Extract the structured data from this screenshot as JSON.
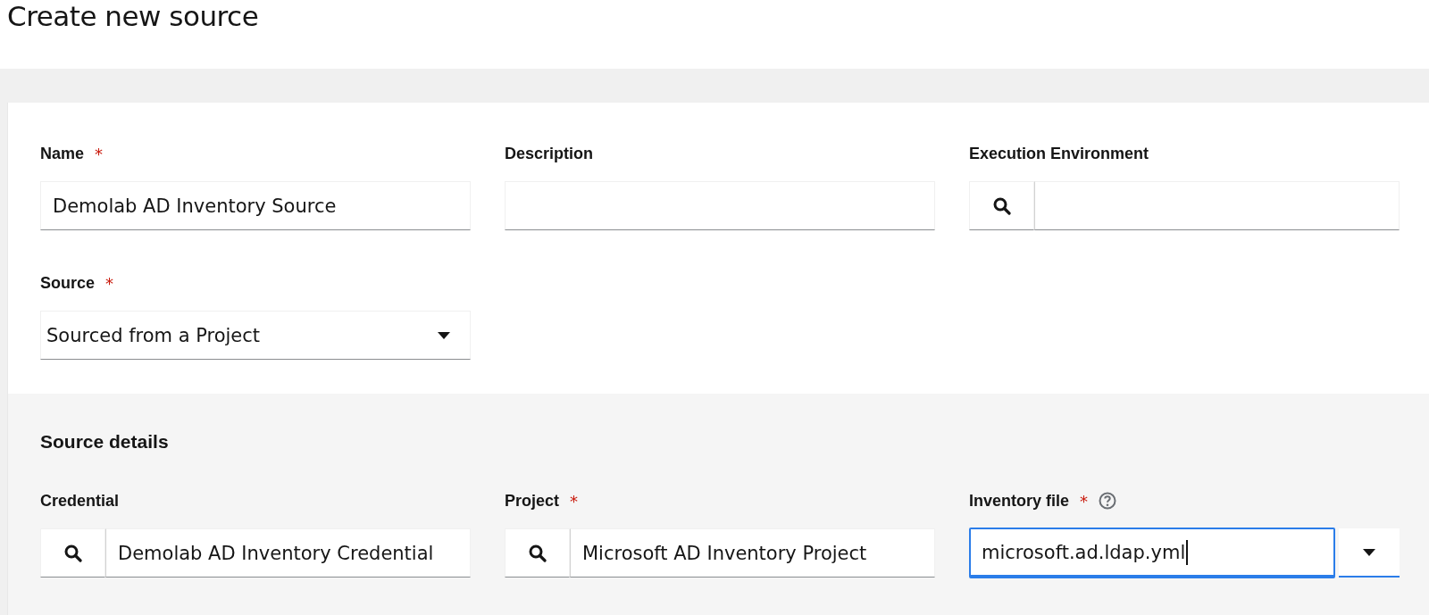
{
  "page": {
    "title": "Create new source"
  },
  "general": {
    "rows": [
      [
        {
          "kind": "text",
          "label": "Name",
          "required_mark": "*",
          "value": "Demolab AD Inventory Source"
        },
        {
          "kind": "text",
          "label": "Description"
        },
        {
          "kind": "lookup",
          "label": "Execution Environment"
        }
      ],
      [
        {
          "kind": "select",
          "label": "Source",
          "required_mark": "*",
          "value": "Sourced from a Project"
        }
      ]
    ]
  },
  "source_details": {
    "title": "Source details",
    "rows": [
      [
        {
          "kind": "lookup",
          "label": "Credential",
          "value": "Demolab AD Inventory Credential"
        },
        {
          "kind": "lookup",
          "label": "Project",
          "required_mark": "*",
          "value": "Microsoft AD Inventory Project"
        },
        {
          "kind": "typeahead",
          "label": "Inventory file",
          "required_mark": "*",
          "help": true,
          "focused": true,
          "value": "microsoft.ad.ldap.yml"
        }
      ]
    ]
  }
}
